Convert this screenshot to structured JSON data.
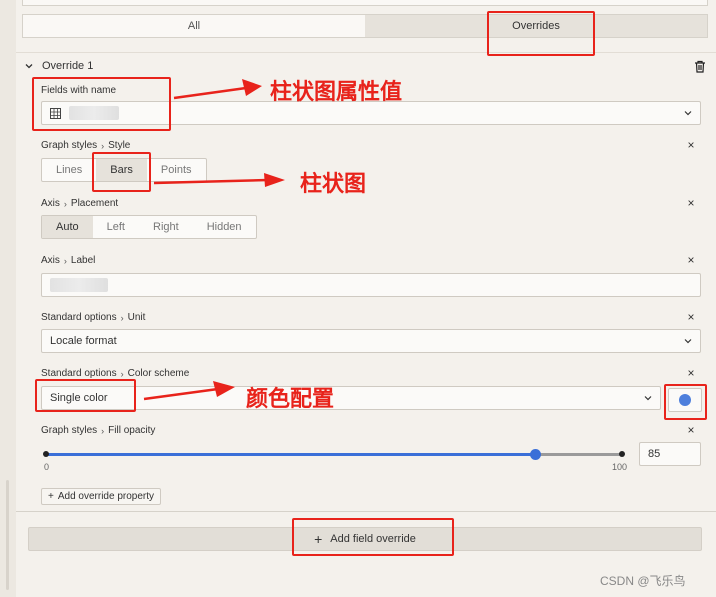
{
  "tabs": {
    "all": "All",
    "overrides": "Overrides"
  },
  "override": {
    "title": "Override 1",
    "fields_label": "Fields with name",
    "graph_style": {
      "group": "Graph styles",
      "prop": "Style",
      "options": [
        "Lines",
        "Bars",
        "Points"
      ],
      "selected": "Bars"
    },
    "axis_placement": {
      "group": "Axis",
      "prop": "Placement",
      "options": [
        "Auto",
        "Left",
        "Right",
        "Hidden"
      ],
      "selected": "Auto"
    },
    "axis_label": {
      "group": "Axis",
      "prop": "Label"
    },
    "unit": {
      "group": "Standard options",
      "prop": "Unit",
      "value": "Locale format"
    },
    "color_scheme": {
      "group": "Standard options",
      "prop": "Color scheme",
      "value": "Single color",
      "color": "#4e7fdc"
    },
    "fill_opacity": {
      "group": "Graph styles",
      "prop": "Fill opacity",
      "min": "0",
      "max": "100",
      "value": "85",
      "fraction": 0.85
    },
    "add_property": "Add override property"
  },
  "add_field_override": "Add field override",
  "annotations": {
    "fields": "柱状图属性值",
    "bars": "柱状图",
    "color": "颜色配置"
  },
  "watermark": "CSDN @飞乐鸟",
  "colors": {
    "accent": "#3a6fd8",
    "annotation": "#e8231b"
  }
}
